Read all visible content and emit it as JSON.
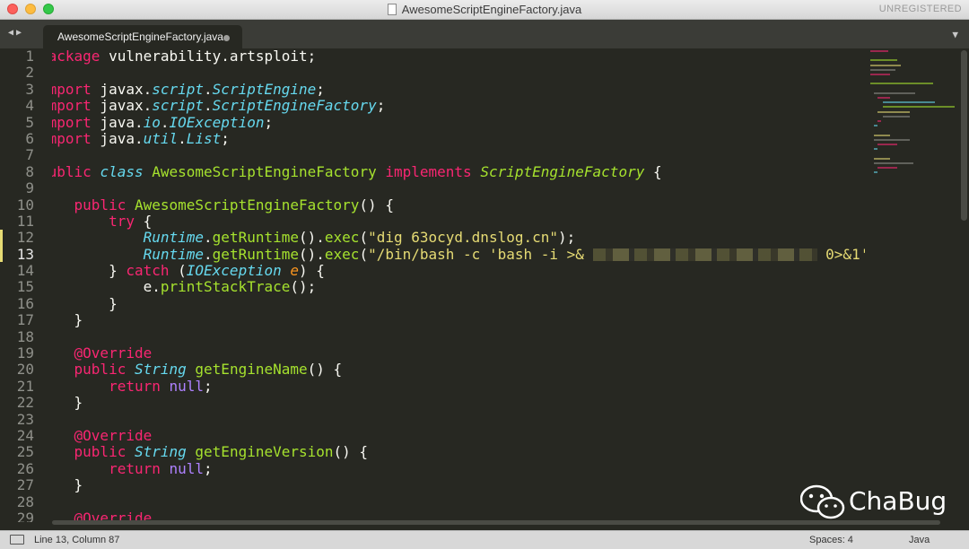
{
  "window": {
    "title": "AwesomeScriptEngineFactory.java",
    "registration": "UNREGISTERED"
  },
  "tabbar": {
    "nav": "◀▶",
    "active_tab": "AwesomeScriptEngineFactory.java",
    "dropdown": "▼"
  },
  "editor": {
    "line_numbers": [
      "1",
      "2",
      "3",
      "4",
      "5",
      "6",
      "7",
      "8",
      "9",
      "10",
      "11",
      "12",
      "13",
      "14",
      "15",
      "16",
      "17",
      "18",
      "19",
      "20",
      "21",
      "22",
      "23",
      "24",
      "25",
      "26",
      "27",
      "28",
      "29"
    ],
    "current_line": 13,
    "redacted_text": "██████"
  },
  "watermark": {
    "text": "ChaBug"
  },
  "status": {
    "position": "Line 13, Column 87",
    "indent": "Spaces: 4",
    "syntax": "Java"
  },
  "colors": {
    "background": "#272822",
    "keyword": "#f92672",
    "type": "#66d9ef",
    "function": "#a6e22e",
    "string": "#e6db74",
    "constant": "#ae81ff"
  }
}
